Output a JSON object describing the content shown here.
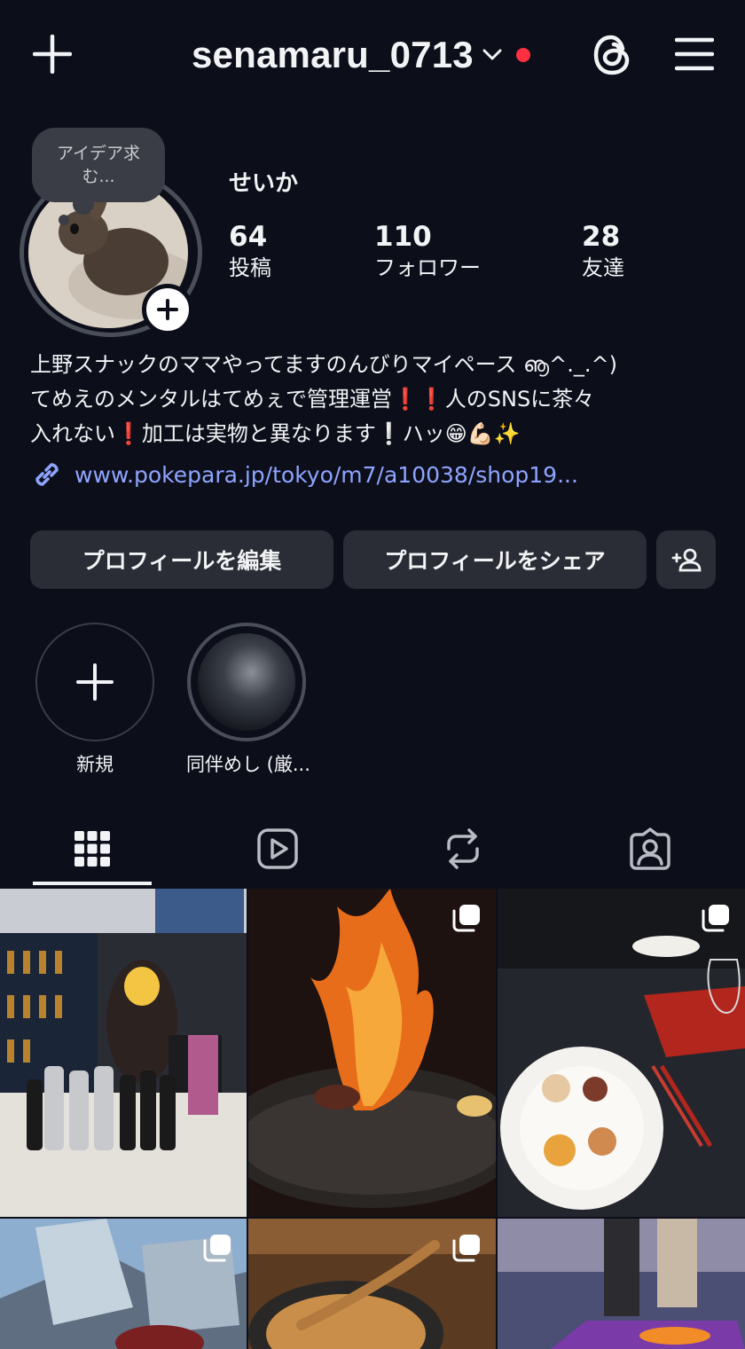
{
  "header": {
    "username": "senamaru_0713",
    "icons": [
      "plus-icon",
      "chevron-down-icon",
      "threads-icon",
      "menu-icon"
    ],
    "notification_color": "#ff3040"
  },
  "profile": {
    "note": "アイデア求む...",
    "display_name": "せいか",
    "stats": [
      {
        "value": "64",
        "label": "投稿"
      },
      {
        "value": "110",
        "label": "フォロワー"
      },
      {
        "value": "28",
        "label": "友達"
      }
    ],
    "bio_lines": [
      "上野スナックのママやってますのんびりマイペース ൡ^._.^)",
      "てめえのメンタルはてめぇで管理運営❗️❗️人のSNSに茶々",
      "入れない❗️加工は実物と異なります❕ハッ😁💪🏻✨"
    ],
    "link": "www.pokepara.jp/tokyo/m7/a10038/shop19..."
  },
  "actions": {
    "edit_label": "プロフィールを編集",
    "share_label": "プロフィールをシェア"
  },
  "highlights": [
    {
      "label": "新規"
    },
    {
      "label": "同伴めし (厳..."
    }
  ],
  "tabs": [
    "grid-icon",
    "reels-icon",
    "reposts-icon",
    "tagged-icon"
  ],
  "colors": {
    "background": "#0c0f1a",
    "button": "#2a2d35",
    "link": "#8fa4ff"
  }
}
